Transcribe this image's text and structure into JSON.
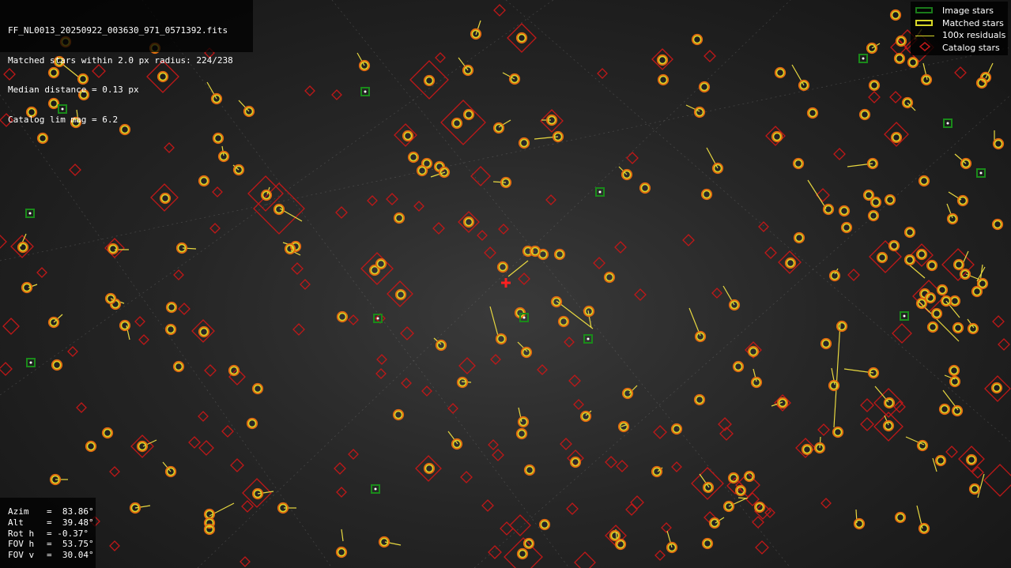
{
  "header": {
    "filename": "FF_NL0013_20250922_003630_971_0571392.fits",
    "matched": "Matched stars within 2.0 px radius: 224/238",
    "median": "Median distance = 0.13 px",
    "catalog": "Catalog lim mag = 6.2"
  },
  "legend": {
    "image_stars": "Image stars",
    "matched_stars": "Matched stars",
    "residuals": "100x residuals",
    "catalog_stars": "Catalog stars"
  },
  "params": [
    {
      "label": "Azim",
      "value": "=  83.86°"
    },
    {
      "label": "Alt",
      "value": "=  39.48°"
    },
    {
      "label": "Rot h",
      "value": "= -0.37°"
    },
    {
      "label": "FOV h",
      "value": "=  53.75°"
    },
    {
      "label": "FOV v",
      "value": "=  30.04°"
    }
  ],
  "colors": {
    "image_star": "#1a8a1a",
    "matched_star": "#d7d728",
    "matched_fill": "#e06a10",
    "residual": "#e8d840",
    "catalog_star": "#c01818",
    "center_marker": "#ff2020"
  }
}
